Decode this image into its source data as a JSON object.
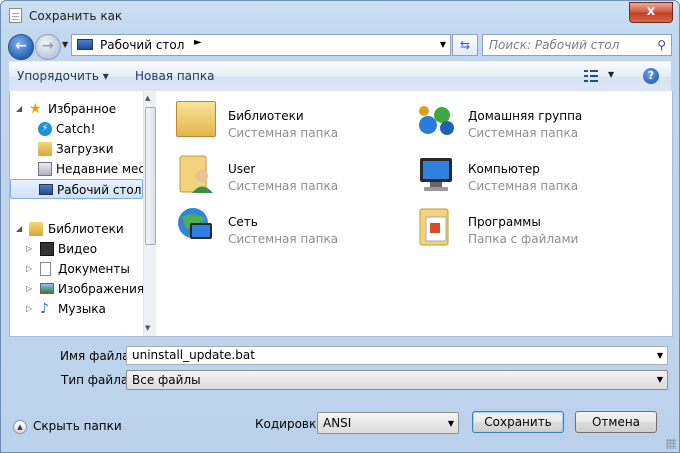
{
  "window": {
    "title": "Сохранить как",
    "close_glyph": "x"
  },
  "nav": {
    "address": "Рабочий стол",
    "search_placeholder": "Поиск: Рабочий стол"
  },
  "toolbar": {
    "organize": "Упорядочить ▾",
    "new_folder": "Новая папка",
    "help": "?"
  },
  "sidebar": {
    "items": [
      {
        "label": "Избранное",
        "icon": "star-icon"
      },
      {
        "label": "Catch!",
        "icon": "catch-icon"
      },
      {
        "label": "Загрузки",
        "icon": "downloads-icon"
      },
      {
        "label": "Недавние места",
        "icon": "recent-places-icon"
      },
      {
        "label": "Рабочий стол",
        "icon": "desktop-icon",
        "selected": true
      },
      {
        "label": "Библиотеки",
        "icon": "libraries-icon"
      },
      {
        "label": "Видео",
        "icon": "video-icon"
      },
      {
        "label": "Документы",
        "icon": "documents-icon"
      },
      {
        "label": "Изображения",
        "icon": "pictures-icon"
      },
      {
        "label": "Музыка",
        "icon": "music-icon"
      }
    ]
  },
  "files": [
    {
      "name": "Библиотеки",
      "type": "Системная папка",
      "icon": "libraries-folder-icon"
    },
    {
      "name": "Домашняя группа",
      "type": "Системная папка",
      "icon": "homegroup-icon"
    },
    {
      "name": "User",
      "type": "Системная папка",
      "icon": "user-folder-icon"
    },
    {
      "name": "Компьютер",
      "type": "Системная папка",
      "icon": "computer-icon"
    },
    {
      "name": "Сеть",
      "type": "Системная папка",
      "icon": "network-icon"
    },
    {
      "name": "Программы",
      "type": "Папка с файлами",
      "icon": "folder-icon"
    }
  ],
  "form": {
    "filename_label": "Имя файла:",
    "filename_value": "uninstall_update.bat",
    "filetype_label": "Тип файла:",
    "filetype_value": "Все файлы",
    "encoding_label": "Кодировка:",
    "encoding_value": "ANSI",
    "hide_folders": "Скрыть папки",
    "save": "Сохранить",
    "cancel": "Отмена"
  }
}
